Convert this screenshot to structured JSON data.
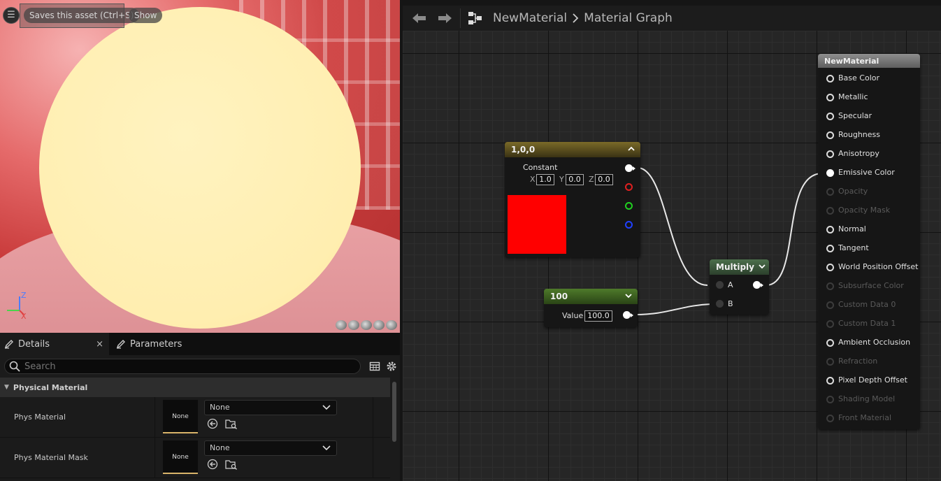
{
  "viewport": {
    "save_tooltip": "Saves this asset (Ctrl+S)",
    "show_button": "Show",
    "axis": {
      "z": "Z",
      "x": "X"
    }
  },
  "details_panel": {
    "tabs": [
      {
        "label": "Details",
        "close": "×"
      },
      {
        "label": "Parameters"
      }
    ],
    "search_placeholder": "Search",
    "category": "Physical Material",
    "properties": [
      {
        "label": "Phys Material",
        "thumb": "None",
        "value": "None"
      },
      {
        "label": "Phys Material Mask",
        "thumb": "None",
        "value": "None"
      }
    ]
  },
  "toolbar": {
    "breadcrumb": [
      "NewMaterial",
      "Material Graph"
    ]
  },
  "graph": {
    "constant_node": {
      "title": "1,0,0",
      "label": "Constant",
      "x_label": "X",
      "x_value": "1.0",
      "y_label": "Y",
      "y_value": "0.0",
      "z_label": "Z",
      "z_value": "0.0",
      "swatch_color": "#ff0000",
      "header_color": "#7a6a28"
    },
    "scalar_node": {
      "title": "100",
      "value_label": "Value",
      "value": "100.0",
      "header_color": "#4e7a2a"
    },
    "multiply_node": {
      "title": "Multiply",
      "input_a": "A",
      "input_b": "B",
      "header_color": "#4c6f4c"
    },
    "material_node": {
      "title": "NewMaterial",
      "inputs": [
        {
          "label": "Base Color",
          "enabled": true
        },
        {
          "label": "Metallic",
          "enabled": true
        },
        {
          "label": "Specular",
          "enabled": true
        },
        {
          "label": "Roughness",
          "enabled": true
        },
        {
          "label": "Anisotropy",
          "enabled": true
        },
        {
          "label": "Emissive Color",
          "enabled": true,
          "connected": true
        },
        {
          "label": "Opacity",
          "enabled": false
        },
        {
          "label": "Opacity Mask",
          "enabled": false
        },
        {
          "label": "Normal",
          "enabled": true
        },
        {
          "label": "Tangent",
          "enabled": true
        },
        {
          "label": "World Position Offset",
          "enabled": true
        },
        {
          "label": "Subsurface Color",
          "enabled": false
        },
        {
          "label": "Custom Data 0",
          "enabled": false
        },
        {
          "label": "Custom Data 1",
          "enabled": false
        },
        {
          "label": "Ambient Occlusion",
          "enabled": true
        },
        {
          "label": "Refraction",
          "enabled": false
        },
        {
          "label": "Pixel Depth Offset",
          "enabled": true
        },
        {
          "label": "Shading Model",
          "enabled": false
        },
        {
          "label": "Front Material",
          "enabled": false
        }
      ]
    }
  }
}
